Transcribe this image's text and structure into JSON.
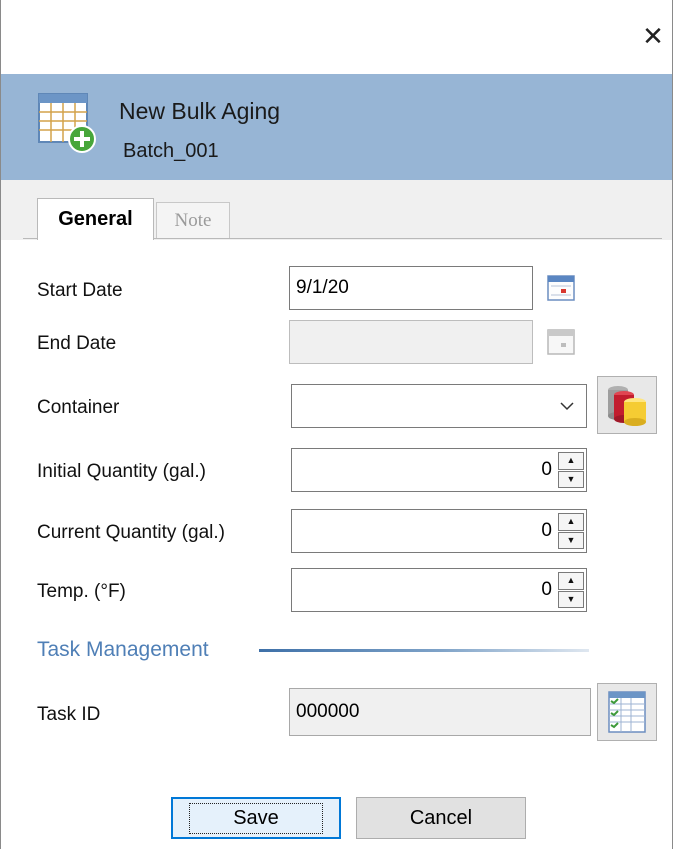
{
  "window": {
    "close_glyph": "✕"
  },
  "header": {
    "title": "New Bulk Aging",
    "subtitle": "Batch_001",
    "icon": "spreadsheet-add-icon"
  },
  "tabs": [
    {
      "label": "General",
      "active": true
    },
    {
      "label": "Note",
      "active": false
    }
  ],
  "form": {
    "start_date": {
      "label": "Start Date",
      "value": "9/1/20"
    },
    "end_date": {
      "label": "End Date",
      "value": ""
    },
    "container": {
      "label": "Container",
      "value": ""
    },
    "initial_quantity": {
      "label": "Initial Quantity (gal.)",
      "value": "0"
    },
    "current_quantity": {
      "label": "Current Quantity (gal.)",
      "value": "0"
    },
    "temp": {
      "label": "Temp. (°F)",
      "value": "0"
    }
  },
  "task_management": {
    "title": "Task Management",
    "task_id": {
      "label": "Task ID",
      "value": "000000"
    }
  },
  "buttons": {
    "save": "Save",
    "cancel": "Cancel"
  },
  "colors": {
    "header_bg": "#97b5d5",
    "section_accent": "#4f7fb6",
    "default_button_border": "#0078d7"
  }
}
